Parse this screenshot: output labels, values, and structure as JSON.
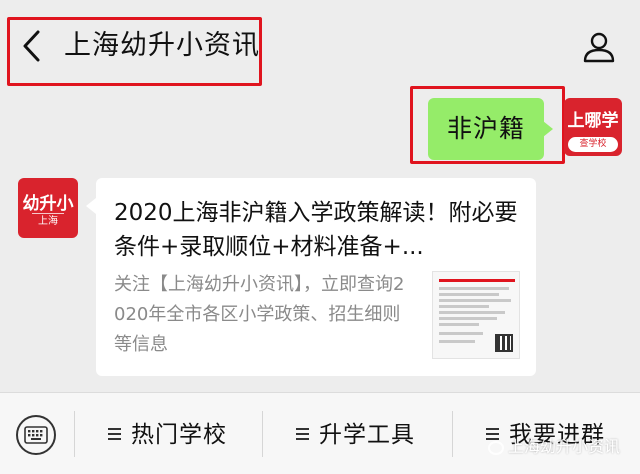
{
  "header": {
    "title": "上海幼升小资讯"
  },
  "sent_message": {
    "text": "非沪籍",
    "bubble_color": "#95ec69",
    "avatar_text": "上哪学",
    "avatar_subtext": "查学校"
  },
  "received": {
    "avatar_main": "幼升小",
    "avatar_sub": "上海",
    "card_title": "2020上海非沪籍入学政策解读！附必要条件+录取顺位+材料准备+...",
    "card_desc": "关注【上海幼升小资讯】，立即查询2020年全市各区小学政策、招生细则等信息"
  },
  "menu": {
    "items": [
      {
        "label": "热门学校"
      },
      {
        "label": "升学工具"
      },
      {
        "label": "我要进群"
      }
    ]
  },
  "watermark": "上海幼升小资讯",
  "colors": {
    "highlight": "#e0141e",
    "brand_red": "#d9232d",
    "background": "#ededed"
  },
  "icons": [
    "back-chevron-icon",
    "user-profile-icon",
    "keyboard-icon",
    "menu-lines-icon"
  ]
}
